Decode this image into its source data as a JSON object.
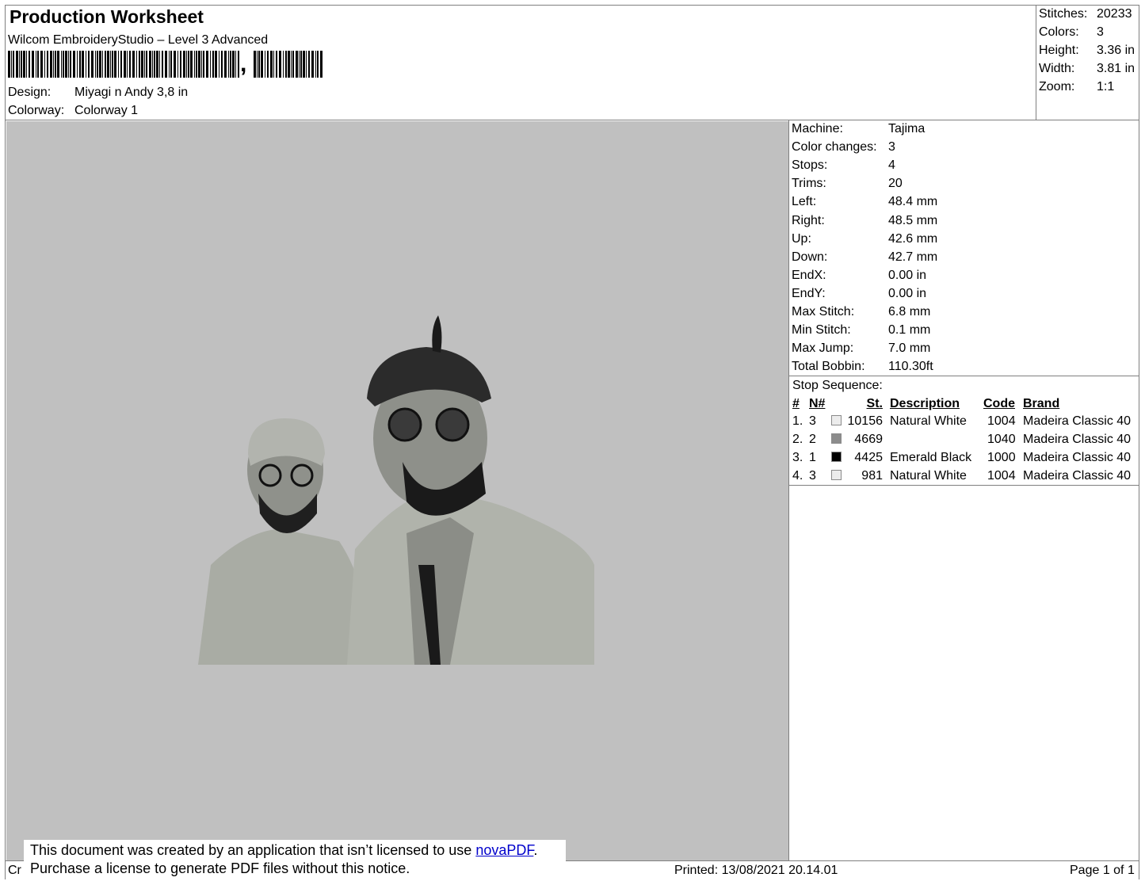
{
  "header": {
    "title": "Production Worksheet",
    "software": "Wilcom EmbroideryStudio – Level 3 Advanced",
    "barcode_suffix": ",",
    "design_label": "Design:",
    "design_value": "Miyagi n Andy 3,8 in",
    "colorway_label": "Colorway:",
    "colorway_value": "Colorway 1"
  },
  "summary": [
    {
      "label": "Stitches:",
      "value": "20233"
    },
    {
      "label": "Colors:",
      "value": "3"
    },
    {
      "label": "Height:",
      "value": "3.36 in"
    },
    {
      "label": "Width:",
      "value": "3.81 in"
    },
    {
      "label": "Zoom:",
      "value": "1:1"
    }
  ],
  "stats": [
    {
      "label": "Machine:",
      "value": "Tajima"
    },
    {
      "label": "Color changes:",
      "value": "3"
    },
    {
      "label": "Stops:",
      "value": "4"
    },
    {
      "label": "Trims:",
      "value": "20"
    },
    {
      "label": "Left:",
      "value": "48.4 mm"
    },
    {
      "label": "Right:",
      "value": "48.5 mm"
    },
    {
      "label": "Up:",
      "value": "42.6 mm"
    },
    {
      "label": "Down:",
      "value": "42.7 mm"
    },
    {
      "label": "EndX:",
      "value": "0.00 in"
    },
    {
      "label": "EndY:",
      "value": "0.00 in"
    },
    {
      "label": "Max Stitch:",
      "value": "6.8 mm"
    },
    {
      "label": "Min Stitch:",
      "value": "0.1 mm"
    },
    {
      "label": "Max Jump:",
      "value": "7.0 mm"
    },
    {
      "label": "Total Bobbin:",
      "value": "110.30ft"
    }
  ],
  "stop_sequence": {
    "title": "Stop Sequence:",
    "headers": {
      "num": "#",
      "n": "N#",
      "st": "St.",
      "desc": "Description",
      "code": "Code",
      "brand": "Brand"
    },
    "rows": [
      {
        "num": "1.",
        "n": "3",
        "color": "#ececec",
        "st": "10156",
        "desc": "Natural White",
        "code": "1004",
        "brand": "Madeira Classic 40"
      },
      {
        "num": "2.",
        "n": "2",
        "color": "#8c8c8c",
        "st": "4669",
        "desc": "",
        "code": "1040",
        "brand": "Madeira Classic 40"
      },
      {
        "num": "3.",
        "n": "1",
        "color": "#000000",
        "st": "4425",
        "desc": "Emerald Black",
        "code": "1000",
        "brand": "Madeira Classic 40"
      },
      {
        "num": "4.",
        "n": "3",
        "color": "#ececec",
        "st": "981",
        "desc": "Natural White",
        "code": "1004",
        "brand": "Madeira Classic 40"
      }
    ]
  },
  "notice": {
    "line1_prefix": "This document was created by an application that isn’t licensed to use ",
    "link": "novaPDF",
    "line1_suffix": ".",
    "line2": "Purchase a license to generate PDF files without this notice."
  },
  "footer": {
    "left_fragment": "Cr",
    "printed": "Printed: 13/08/2021 20.14.01",
    "page": "Page 1 of 1"
  }
}
